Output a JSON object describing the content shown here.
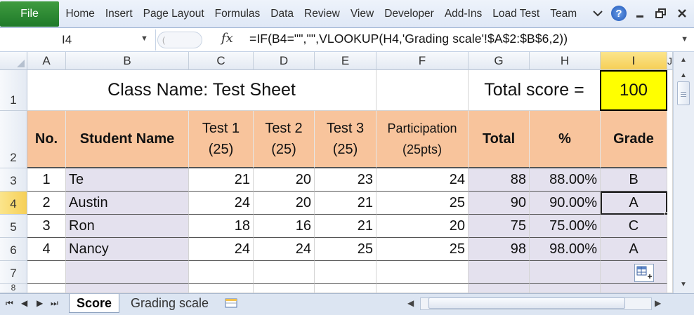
{
  "ribbon": {
    "file_label": "File",
    "tabs": [
      "Home",
      "Insert",
      "Page Layout",
      "Formulas",
      "Data",
      "Review",
      "View",
      "Developer",
      "Add-Ins",
      "Load Test",
      "Team"
    ]
  },
  "formula_bar": {
    "name_box": "I4",
    "fx_label": "fx",
    "formula": "=IF(B4=\"\",\"\",VLOOKUP(H4,'Grading scale'!$A$2:$B$6,2))"
  },
  "columns": [
    "A",
    "B",
    "C",
    "D",
    "E",
    "F",
    "G",
    "H",
    "I",
    "J"
  ],
  "rows": [
    "1",
    "2",
    "3",
    "4",
    "5",
    "6",
    "7",
    "8"
  ],
  "sheet": {
    "title": "Class Name: Test Sheet",
    "total_label": "Total score =",
    "total_value": "100",
    "headers": {
      "no": "No.",
      "name": "Student Name",
      "test1_a": "Test 1",
      "test1_b": "(25)",
      "test2_a": "Test 2",
      "test2_b": "(25)",
      "test3_a": "Test 3",
      "test3_b": "(25)",
      "part_a": "Participation",
      "part_b": "(25pts)",
      "total": "Total",
      "pct": "%",
      "grade": "Grade"
    },
    "students": [
      {
        "no": "1",
        "name": "Te",
        "t1": "21",
        "t2": "20",
        "t3": "23",
        "part": "24",
        "total": "88",
        "pct": "88.00%",
        "grade": "B"
      },
      {
        "no": "2",
        "name": "Austin",
        "t1": "24",
        "t2": "20",
        "t3": "21",
        "part": "25",
        "total": "90",
        "pct": "90.00%",
        "grade": "A"
      },
      {
        "no": "3",
        "name": "Ron",
        "t1": "18",
        "t2": "16",
        "t3": "21",
        "part": "20",
        "total": "75",
        "pct": "75.00%",
        "grade": "C"
      },
      {
        "no": "4",
        "name": "Nancy",
        "t1": "24",
        "t2": "24",
        "t3": "25",
        "part": "25",
        "total": "98",
        "pct": "98.00%",
        "grade": "A"
      }
    ]
  },
  "sheet_tabs": [
    "Score",
    "Grading scale"
  ],
  "colors": {
    "header_fill": "#f8c49c",
    "lavender_fill": "#e4e1ee",
    "total_fill": "#ffff00",
    "file_tab": "#2a8a35",
    "selection": "#f6cf57"
  }
}
